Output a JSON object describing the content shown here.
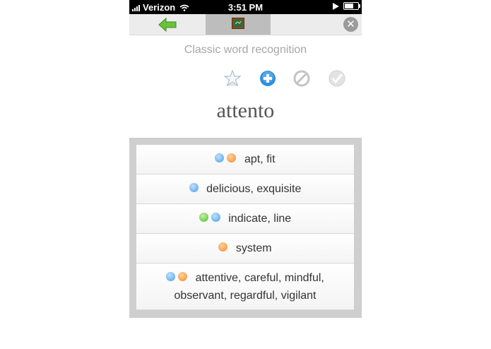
{
  "status_bar": {
    "carrier": "Verizon",
    "time": "3:51 PM"
  },
  "toolbar": {
    "back_icon": "green-arrow-left-icon",
    "center_icon": "chalkboard-icon",
    "close_label": "✕"
  },
  "mode_title": "Classic word recognition",
  "actions": [
    {
      "name": "favorite-star-button",
      "icon": "star-icon"
    },
    {
      "name": "add-button",
      "icon": "plus-circle-icon"
    },
    {
      "name": "block-button",
      "icon": "prohibited-icon"
    },
    {
      "name": "check-button",
      "icon": "checkmark-icon"
    }
  ],
  "word": "attento",
  "choices": [
    {
      "text": "apt, fit",
      "dots": [
        "blue",
        "orange"
      ]
    },
    {
      "text": "delicious, exquisite",
      "dots": [
        "blue"
      ]
    },
    {
      "text": "indicate, line",
      "dots": [
        "green",
        "blue"
      ]
    },
    {
      "text": "system",
      "dots": [
        "orange"
      ]
    },
    {
      "text": "attentive, careful, mindful, observant, regardful, vigilant",
      "dots": [
        "blue",
        "orange"
      ]
    }
  ],
  "colors": {
    "blue": "#4a9de8",
    "orange": "#f08a24",
    "green": "#4bbf2a"
  }
}
